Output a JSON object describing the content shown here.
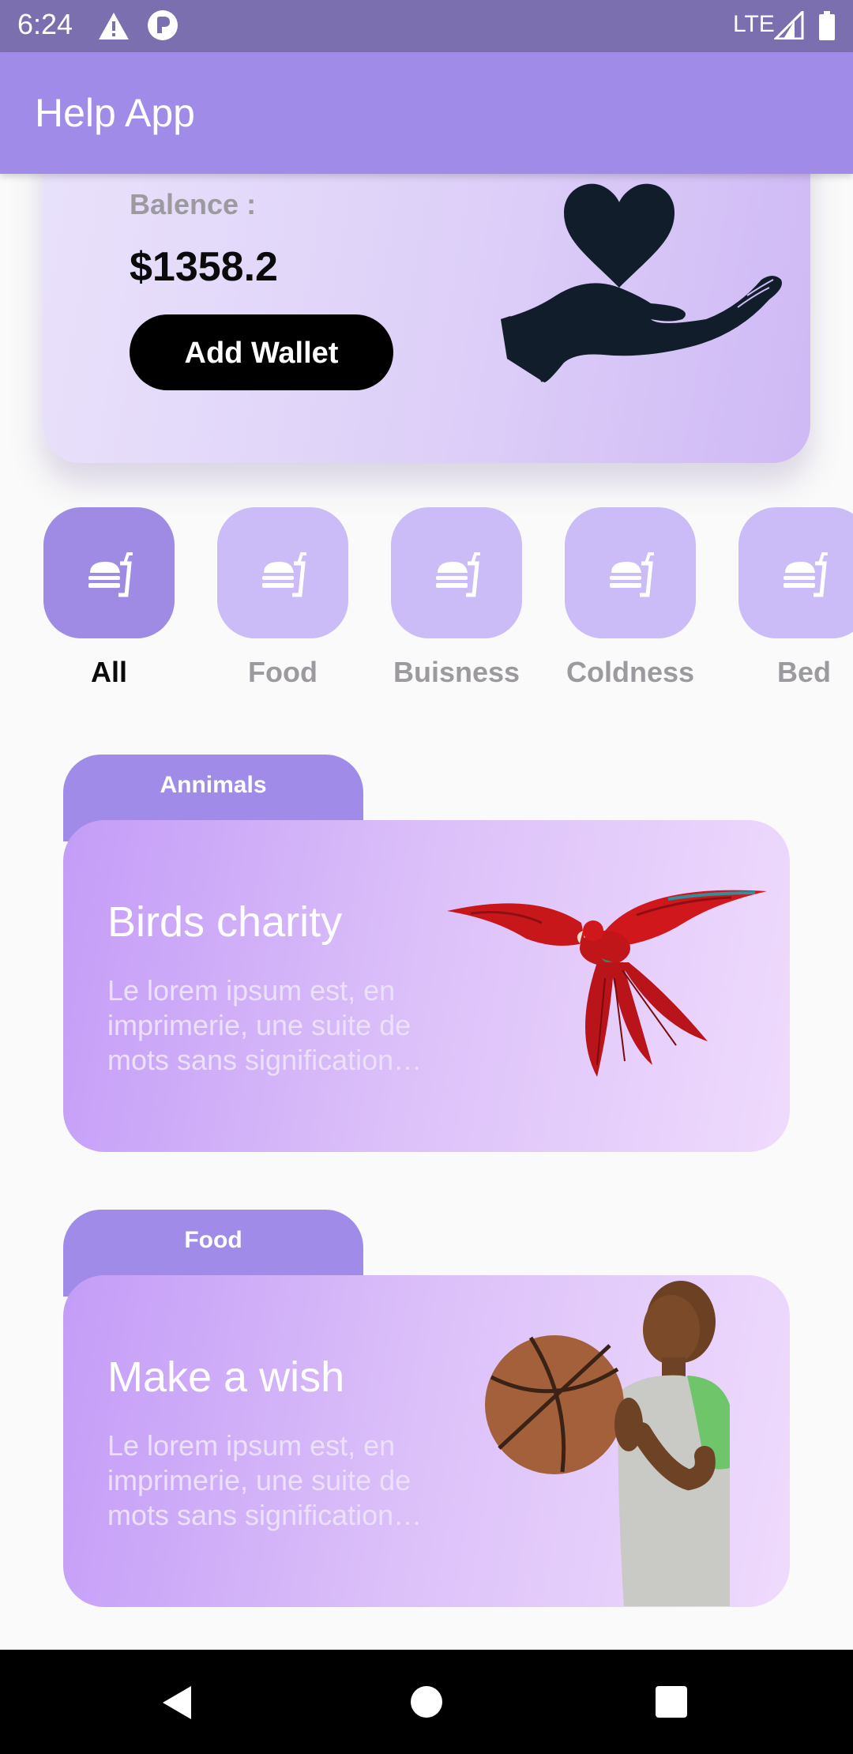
{
  "status_bar": {
    "time": "6:24",
    "network": "LTE"
  },
  "app_bar": {
    "title": "Help App"
  },
  "balance_card": {
    "label": "Balence :",
    "amount": "$1358.2",
    "add_wallet_label": "Add Wallet",
    "icon": "heart-in-hand-icon"
  },
  "categories": [
    {
      "label": "All",
      "icon": "food-icon",
      "active": true
    },
    {
      "label": "Food",
      "icon": "food-icon",
      "active": false
    },
    {
      "label": "Buisness",
      "icon": "food-icon",
      "active": false
    },
    {
      "label": "Coldness",
      "icon": "food-icon",
      "active": false
    },
    {
      "label": "Bed",
      "icon": "food-icon",
      "active": false
    }
  ],
  "cards": [
    {
      "tag": "Annimals",
      "title": "Birds charity",
      "description": "Le lorem ipsum est, en imprimerie, une suite de mots sans signification…",
      "image": "parrot-image"
    },
    {
      "tag": "Food",
      "title": "Make a wish",
      "description": "Le lorem ipsum est, en imprimerie, une suite de mots sans signification…",
      "image": "child-basketball-image"
    }
  ],
  "colors": {
    "status_bar": "#7b6fb0",
    "app_bar": "#a08ce8",
    "category_active": "#9f8be3",
    "category_inactive": "#cbbcf7",
    "card_gradient_start": "#c49cf7",
    "card_gradient_end": "#efdbfd"
  }
}
